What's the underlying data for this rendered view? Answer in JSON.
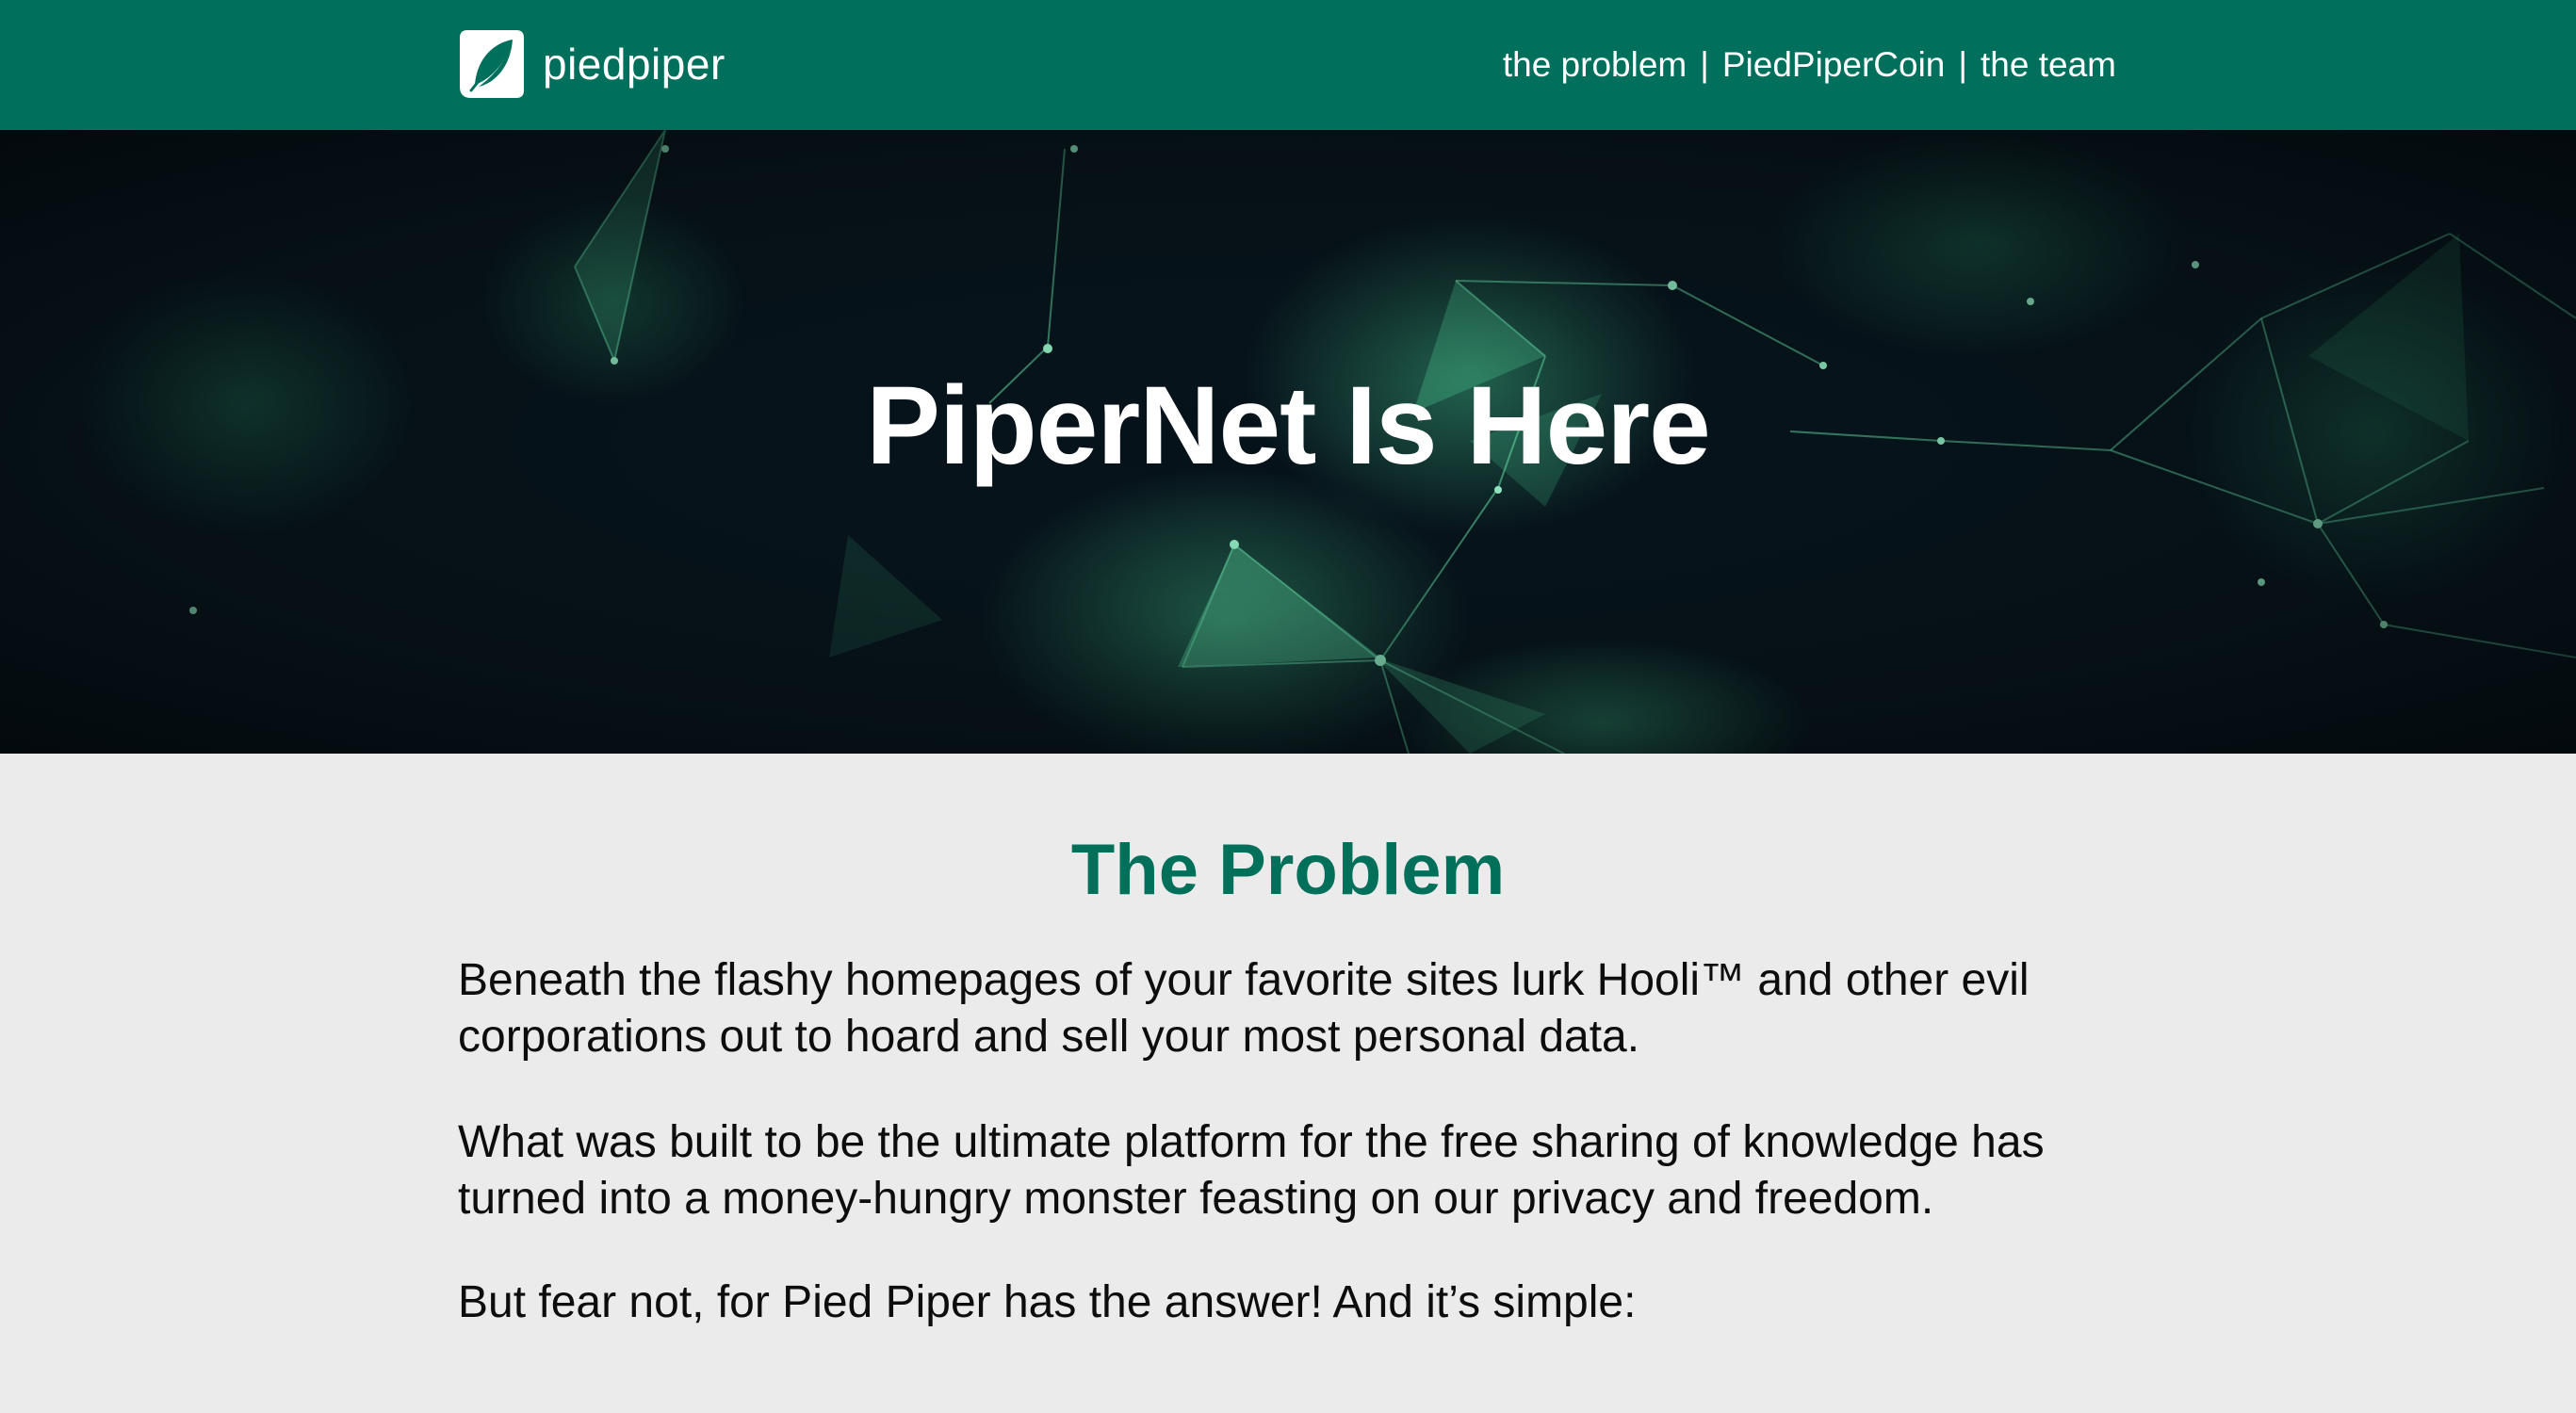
{
  "brand": {
    "name": "piedpiper"
  },
  "nav": {
    "items": [
      "the problem",
      "PiedPiperCoin",
      "the team"
    ],
    "separator": "|"
  },
  "hero": {
    "title": "PiperNet Is Here"
  },
  "problem": {
    "title": "The Problem",
    "paragraphs": [
      "Beneath the flashy homepages of your favorite sites lurk Hooli™ and other evil corporations out to hoard and sell your most personal data.",
      "What was built to be the ultimate platform for the free sharing of knowledge has turned into a money-hungry monster feasting on our privacy and freedom.",
      "But fear not, for Pied Piper has the answer! And it’s simple:"
    ]
  },
  "colors": {
    "header_bg": "#006f5c",
    "accent": "#00705b",
    "content_bg": "#ebebeb",
    "hero_bg": "#050d12",
    "network_glow": "#4fd39a"
  },
  "icons": {
    "logo": "leaf-logo-icon"
  }
}
